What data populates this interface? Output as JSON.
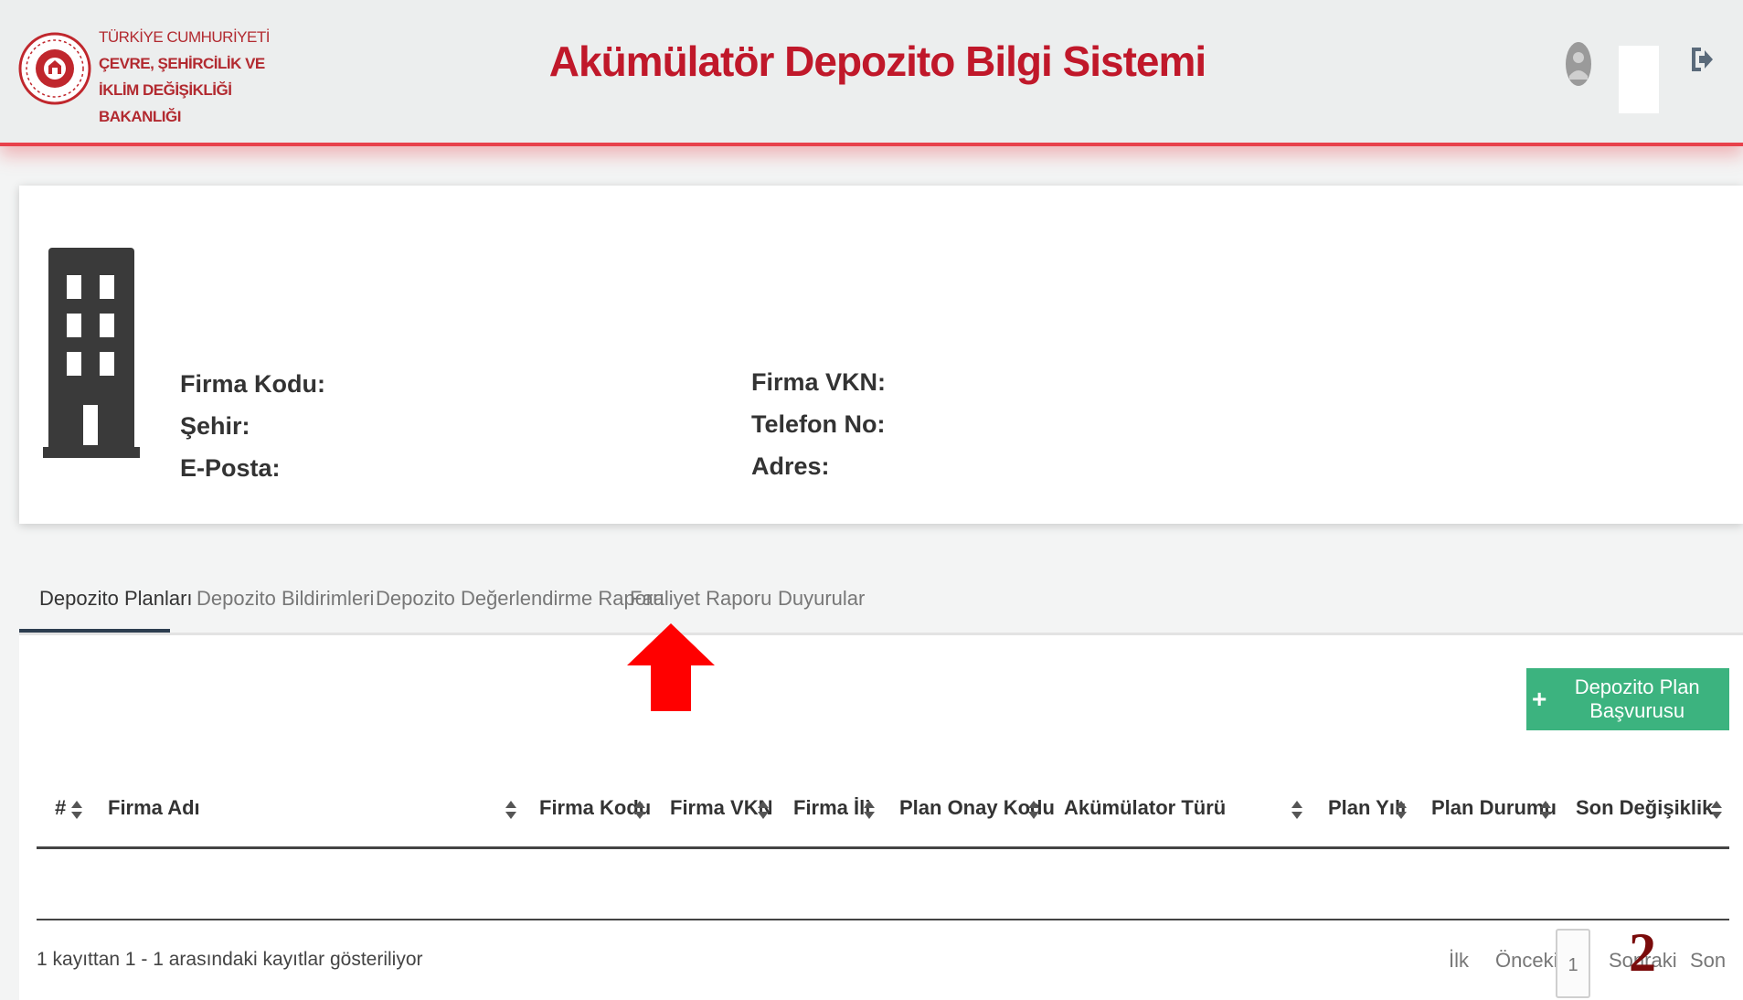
{
  "header": {
    "logo_lines": [
      "TÜRKİYE CUMHURİYETİ",
      "ÇEVRE, ŞEHİRCİLİK VE",
      "İKLİM DEĞİŞİKLİĞİ BAKANLIĞI"
    ],
    "title": "Akümülatör Depozito Bilgi Sistemi",
    "brand_color": "#c0182a",
    "accent_line_color": "#e8414b"
  },
  "company": {
    "fields_left": [
      {
        "label": "Firma Kodu:"
      },
      {
        "label": "Şehir:"
      },
      {
        "label": "E-Posta:"
      }
    ],
    "fields_right": [
      {
        "label": "Firma VKN:"
      },
      {
        "label": "Telefon No:"
      },
      {
        "label": "Adres:"
      }
    ]
  },
  "tabs": [
    {
      "label": "Depozito Planları",
      "active": true
    },
    {
      "label": "Depozito Bildirimleri",
      "active": false
    },
    {
      "label": "Depozito Değerlendirme Raporu",
      "active": false
    },
    {
      "label": "Faaliyet Raporu",
      "active": false
    },
    {
      "label": "Duyurular",
      "active": false
    }
  ],
  "toolbar": {
    "add_button_label": "Depozito Plan Başvurusu",
    "add_button_color": "#3cb37f"
  },
  "table": {
    "columns": [
      "#",
      "Firma Adı",
      "Firma Kodu",
      "Firma VKN",
      "Firma İli",
      "Plan Onay Kodu",
      "Akümülator Türü",
      "Plan Yılı",
      "Plan Durumu",
      "Son Değişiklik"
    ],
    "rows": []
  },
  "footer": {
    "info": "1 kayıttan 1 - 1 arasındaki kayıtlar gösteriliyor",
    "pagination": {
      "first": "İlk",
      "prev": "Önceki",
      "current": "1",
      "next": "Sonraki",
      "last": "Son"
    }
  },
  "annotation": {
    "step_number": "2",
    "arrow_color": "#ff0000"
  }
}
